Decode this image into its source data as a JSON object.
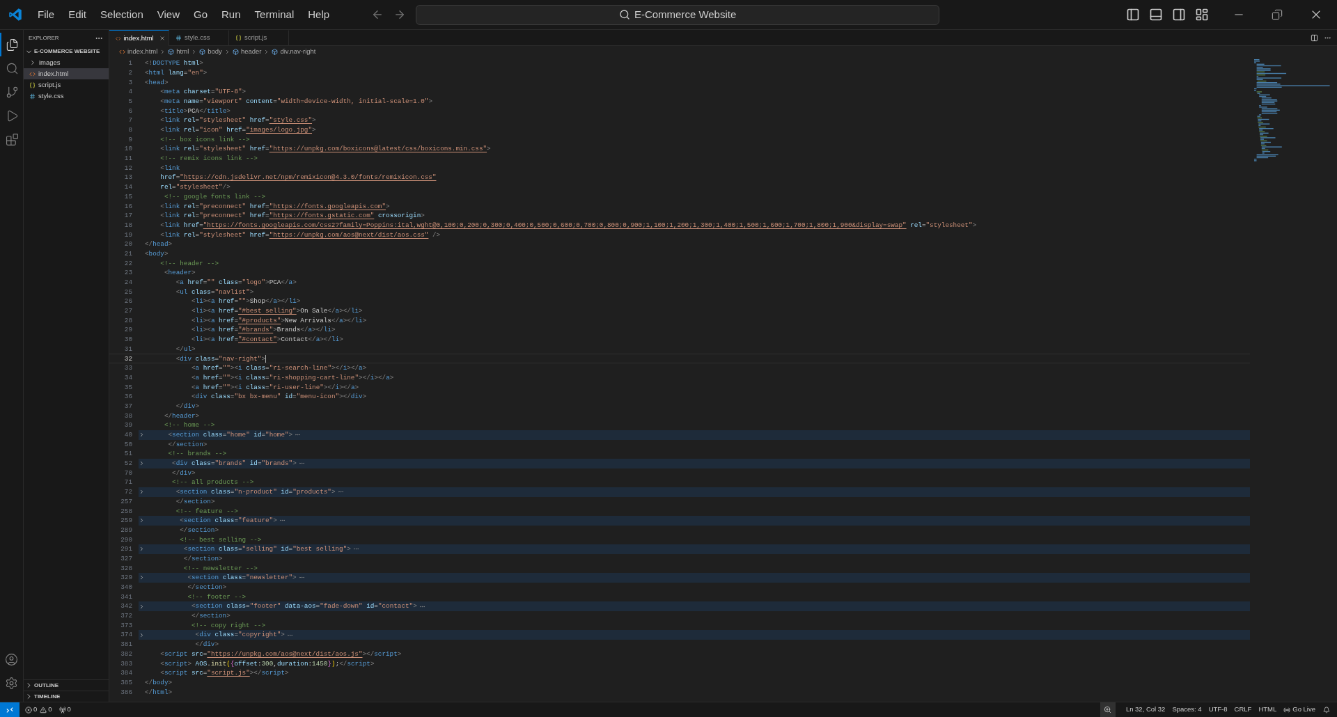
{
  "title_bar": {
    "menus": [
      "File",
      "Edit",
      "Selection",
      "View",
      "Go",
      "Run",
      "Terminal",
      "Help"
    ],
    "command_center": "E-Commerce Website"
  },
  "activity_bar": {
    "top": [
      {
        "kind": "explorer",
        "selected": true
      },
      {
        "kind": "search",
        "selected": false
      },
      {
        "kind": "source-control",
        "selected": false
      },
      {
        "kind": "run",
        "selected": false
      },
      {
        "kind": "extensions",
        "selected": false
      }
    ],
    "bottom": [
      {
        "kind": "account"
      },
      {
        "kind": "settings"
      }
    ]
  },
  "explorer": {
    "title": "EXPLORER",
    "folder": {
      "name": "E-COMMERCE WEBSITE",
      "expanded": true,
      "items": [
        {
          "name": "images",
          "kind": "folder",
          "expanded": false,
          "selected": false
        },
        {
          "name": "index.html",
          "kind": "html",
          "selected": true
        },
        {
          "name": "script.js",
          "kind": "js",
          "selected": false
        },
        {
          "name": "style.css",
          "kind": "css",
          "selected": false
        }
      ]
    },
    "sections": [
      {
        "name": "OUTLINE",
        "expanded": false
      },
      {
        "name": "TIMELINE",
        "expanded": false
      }
    ]
  },
  "tabs": [
    {
      "label": "index.html",
      "kind": "html",
      "selected": true
    },
    {
      "label": "style.css",
      "kind": "css",
      "selected": false
    },
    {
      "label": "script.js",
      "kind": "js",
      "selected": false
    }
  ],
  "breadcrumb": [
    {
      "label": "index.html",
      "kind": "html"
    },
    {
      "label": "html",
      "kind": "element"
    },
    {
      "label": "body",
      "kind": "element"
    },
    {
      "label": "header",
      "kind": "element"
    },
    {
      "label": "div.nav-right",
      "kind": "element"
    }
  ],
  "editor": {
    "lines": [
      {
        "no": "1",
        "folded": false,
        "current": false,
        "text": "<!DOCTYPE html>"
      },
      {
        "no": "2",
        "folded": false,
        "current": false,
        "text": "<html lang=\"en\">"
      },
      {
        "no": "3",
        "folded": false,
        "current": false,
        "text": "<head>"
      },
      {
        "no": "4",
        "folded": false,
        "current": false,
        "text": "    <meta charset=\"UTF-8\">"
      },
      {
        "no": "5",
        "folded": false,
        "current": false,
        "text": "    <meta name=\"viewport\" content=\"width=device-width, initial-scale=1.0\">"
      },
      {
        "no": "6",
        "folded": false,
        "current": false,
        "text": "    <title>PCA</title>"
      },
      {
        "no": "7",
        "folded": false,
        "current": false,
        "text": "    <link rel=\"stylesheet\" href=\"style.css\">"
      },
      {
        "no": "8",
        "folded": false,
        "current": false,
        "text": "    <link rel=\"icon\" href=\"images/logo.jpg\">"
      },
      {
        "no": "9",
        "folded": false,
        "current": false,
        "text": "    <!-- box icons link -->"
      },
      {
        "no": "10",
        "folded": false,
        "current": false,
        "text": "    <link rel=\"stylesheet\" href=\"https://unpkg.com/boxicons@latest/css/boxicons.min.css\">"
      },
      {
        "no": "11",
        "folded": false,
        "current": false,
        "text": "    <!-- remix icons link -->"
      },
      {
        "no": "12",
        "folded": false,
        "current": false,
        "text": "    <link"
      },
      {
        "no": "13",
        "folded": false,
        "current": false,
        "text": "    href=\"https://cdn.jsdelivr.net/npm/remixicon@4.3.0/fonts/remixicon.css\""
      },
      {
        "no": "14",
        "folded": false,
        "current": false,
        "text": "    rel=\"stylesheet\"/>"
      },
      {
        "no": "15",
        "folded": false,
        "current": false,
        "text": "     <!-- google fonts link -->"
      },
      {
        "no": "16",
        "folded": false,
        "current": false,
        "text": "    <link rel=\"preconnect\" href=\"https://fonts.googleapis.com\">"
      },
      {
        "no": "17",
        "folded": false,
        "current": false,
        "text": "    <link rel=\"preconnect\" href=\"https://fonts.gstatic.com\" crossorigin>"
      },
      {
        "no": "18",
        "folded": false,
        "current": false,
        "text": "    <link href=\"https://fonts.googleapis.com/css2?family=Poppins:ital,wght@0,100;0,200;0,300;0,400;0,500;0,600;0,700;0,800;0,900;1,100;1,200;1,300;1,400;1,500;1,600;1,700;1,800;1,900&display=swap\" rel=\"stylesheet\">"
      },
      {
        "no": "19",
        "folded": false,
        "current": false,
        "text": "    <link rel=\"stylesheet\" href=\"https://unpkg.com/aos@next/dist/aos.css\" />"
      },
      {
        "no": "20",
        "folded": false,
        "current": false,
        "text": "</head>"
      },
      {
        "no": "21",
        "folded": false,
        "current": false,
        "text": "<body>"
      },
      {
        "no": "22",
        "folded": false,
        "current": false,
        "text": "    <!-- header -->"
      },
      {
        "no": "23",
        "folded": false,
        "current": false,
        "text": "     <header>"
      },
      {
        "no": "24",
        "folded": false,
        "current": false,
        "text": "        <a href=\"\" class=\"logo\">PCA</a>"
      },
      {
        "no": "25",
        "folded": false,
        "current": false,
        "text": "        <ul class=\"navlist\">"
      },
      {
        "no": "26",
        "folded": false,
        "current": false,
        "text": "            <li><a href=\"\">Shop</a></li>"
      },
      {
        "no": "27",
        "folded": false,
        "current": false,
        "text": "            <li><a href=\"#best selling\">On Sale</a></li>"
      },
      {
        "no": "28",
        "folded": false,
        "current": false,
        "text": "            <li><a href=\"#products\">New Arrivals</a></li>"
      },
      {
        "no": "29",
        "folded": false,
        "current": false,
        "text": "            <li><a href=\"#brands\">Brands</a></li>"
      },
      {
        "no": "30",
        "folded": false,
        "current": false,
        "text": "            <li><a href=\"#contact\">Contact</a></li>"
      },
      {
        "no": "31",
        "folded": false,
        "current": false,
        "text": "        </ul>"
      },
      {
        "no": "32",
        "folded": false,
        "current": true,
        "text": "        <div class=\"nav-right\">"
      },
      {
        "no": "33",
        "folded": false,
        "current": false,
        "text": "            <a href=\"\"><i class=\"ri-search-line\"></i></a>"
      },
      {
        "no": "34",
        "folded": false,
        "current": false,
        "text": "            <a href=\"\"><i class=\"ri-shopping-cart-line\"></i></a>"
      },
      {
        "no": "35",
        "folded": false,
        "current": false,
        "text": "            <a href=\"\"><i class=\"ri-user-line\"></i></a>"
      },
      {
        "no": "36",
        "folded": false,
        "current": false,
        "text": "            <div class=\"bx bx-menu\" id=\"menu-icon\"></div>"
      },
      {
        "no": "37",
        "folded": false,
        "current": false,
        "text": "        </div>"
      },
      {
        "no": "38",
        "folded": false,
        "current": false,
        "text": "     </header>"
      },
      {
        "no": "39",
        "folded": false,
        "current": false,
        "text": "     <!-- home -->"
      },
      {
        "no": "40",
        "folded": true,
        "current": false,
        "text": "      <section class=\"home\" id=\"home\">"
      },
      {
        "no": "50",
        "folded": false,
        "current": false,
        "text": "      </section>"
      },
      {
        "no": "51",
        "folded": false,
        "current": false,
        "text": "      <!-- brands -->"
      },
      {
        "no": "52",
        "folded": true,
        "current": false,
        "text": "       <div class=\"brands\" id=\"brands\">"
      },
      {
        "no": "70",
        "folded": false,
        "current": false,
        "text": "       </div>"
      },
      {
        "no": "71",
        "folded": false,
        "current": false,
        "text": "       <!-- all products -->"
      },
      {
        "no": "72",
        "folded": true,
        "current": false,
        "text": "        <section class=\"n-product\" id=\"products\">"
      },
      {
        "no": "257",
        "folded": false,
        "current": false,
        "text": "        </section>"
      },
      {
        "no": "258",
        "folded": false,
        "current": false,
        "text": "        <!-- feature -->"
      },
      {
        "no": "259",
        "folded": true,
        "current": false,
        "text": "         <section class=\"feature\">"
      },
      {
        "no": "289",
        "folded": false,
        "current": false,
        "text": "         </section>"
      },
      {
        "no": "290",
        "folded": false,
        "current": false,
        "text": "         <!-- best selling -->"
      },
      {
        "no": "291",
        "folded": true,
        "current": false,
        "text": "          <section class=\"selling\" id=\"best selling\">"
      },
      {
        "no": "327",
        "folded": false,
        "current": false,
        "text": "          </section>"
      },
      {
        "no": "328",
        "folded": false,
        "current": false,
        "text": "          <!-- newsletter -->"
      },
      {
        "no": "329",
        "folded": true,
        "current": false,
        "text": "           <section class=\"newsletter\">"
      },
      {
        "no": "340",
        "folded": false,
        "current": false,
        "text": "           </section>"
      },
      {
        "no": "341",
        "folded": false,
        "current": false,
        "text": "           <!-- footer -->"
      },
      {
        "no": "342",
        "folded": true,
        "current": false,
        "text": "            <section class=\"footer\" data-aos=\"fade-down\" id=\"contact\">"
      },
      {
        "no": "372",
        "folded": false,
        "current": false,
        "text": "            </section>"
      },
      {
        "no": "373",
        "folded": false,
        "current": false,
        "text": "            <!-- copy right -->"
      },
      {
        "no": "374",
        "folded": true,
        "current": false,
        "text": "             <div class=\"copyright\">"
      },
      {
        "no": "381",
        "folded": false,
        "current": false,
        "text": "             </div>"
      },
      {
        "no": "382",
        "folded": false,
        "current": false,
        "text": "    <script src=\"https://unpkg.com/aos@next/dist/aos.js\"></script>"
      },
      {
        "no": "383",
        "folded": false,
        "current": false,
        "text": "    <script> AOS.init({offset:300,duration:1450});</script>"
      },
      {
        "no": "384",
        "folded": false,
        "current": false,
        "text": "    <script src=\"script.js\"></script>"
      },
      {
        "no": "385",
        "folded": false,
        "current": false,
        "text": "</body>"
      },
      {
        "no": "386",
        "folded": false,
        "current": false,
        "text": "</html>"
      }
    ]
  },
  "status_bar": {
    "errors": "0",
    "warnings": "0",
    "ports": "0",
    "position": "Ln 32, Col 32",
    "indentation": "Spaces: 4",
    "encoding": "UTF-8",
    "line_ending": "CRLF",
    "language": "HTML",
    "live_server": "Go Live"
  }
}
